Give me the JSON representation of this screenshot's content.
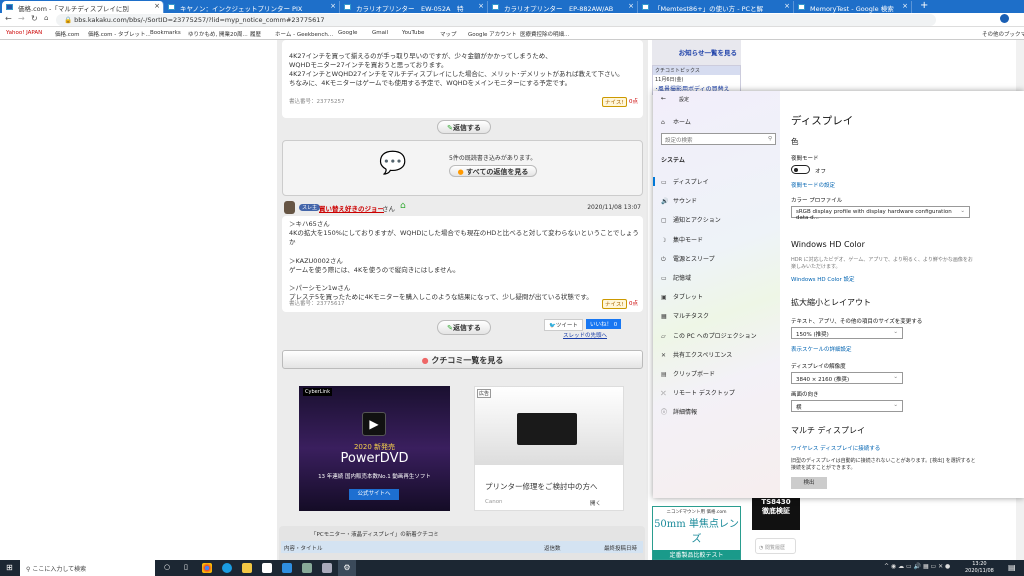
{
  "browser": {
    "tabs": [
      {
        "title": "価格.com -「マルチディスプレイに別",
        "active": true
      },
      {
        "title": "キヤノン：インクジェットプリンター PIX"
      },
      {
        "title": "カラリオプリンター　EW-052A　特"
      },
      {
        "title": "カラリオプリンター　EP-882AW/AB"
      },
      {
        "title": "「Memtest86+」の使い方 - PCと解"
      },
      {
        "title": "MemoryTest - Google 検索"
      }
    ],
    "url": "bbs.kakaku.com/bbs/-/SortID=23775257/?lid=myp_notice_comm#23775617",
    "bookmarks": [
      "Yahoo! JAPAN",
      "価格.com",
      "価格.com - タブレット...",
      "Bookmarks",
      "ゆりかもめ, 開業20周...",
      "履歴",
      "ホーム - Geekbench...",
      "Google",
      "Gmail",
      "YouTube",
      "マップ",
      "Google アカウント",
      "医療費控除の明細..."
    ],
    "other_bookmarks": "その他のブックマーク"
  },
  "forum": {
    "post1": {
      "lines": [
        "4K27インチを買って揃えるのが手っ取り早いのですが、少々金額がかかってしまうため、",
        "WQHDモニター27インチを買おうと思っております。",
        "4K27インチとWQHD27インチをマルチディスプレイにした場合に、メリット･デメリットがあれば教えて下さい。",
        "ちなみに、4Kモニターはゲームでも使用する予定で、WQHDをメインモニターにする予定です。"
      ],
      "number": "書込番号：23775257",
      "nice": "ナイス!",
      "points": "0点"
    },
    "reply_label": "返信する",
    "unread_text": "5件の既読書き込みがあります。",
    "all_replies": "すべての返信を見る",
    "post2": {
      "badge": "スレ主",
      "author": "買い替え好きのジョー",
      "suffix": "さん",
      "date": "2020/11/08 13:07",
      "lines": [
        "＞キハ65さん",
        "4Kの拡大を150%にしておりますが、WQHDにした場合でも現在のHDと比べると対して変わらないということでしょうか",
        "",
        "＞KAZU0002さん",
        "ゲームを使う際には、4Kを使うので縦向きにはしません。",
        "",
        "＞パーシモン1wさん",
        "プレステ5を買ったために4Kモニターを購入しこのような結果になって、少し疑問が出ている状態です。"
      ],
      "number": "書込番号：23775617",
      "nice": "ナイス!",
      "points": "0点"
    },
    "tweet": "ツイート",
    "like": "いいね！ 0",
    "thread_top": "スレッドの先頭へ",
    "kuchikomi_list": "クチコミ一覧を見る",
    "ad1": {
      "brand": "CyberLink",
      "headline": "2020 新発売",
      "product": "PowerDVD",
      "sub": "13 年連続 国内販売本数No.1 動画再生ソフト",
      "cta": "公式サイトへ"
    },
    "ad2": {
      "tag": "広告",
      "headline": "プリンター修理をご検討中の方へ",
      "advertiser": "Canon",
      "open": "開く"
    },
    "new_section": {
      "title": "「PCモニター・液晶ディスプレイ」の新着クチコミ",
      "col_title": "内容・タイトル",
      "col_replies": "返信数",
      "col_date": "最終投稿日時"
    }
  },
  "sidebar": {
    "notice_link": "お知らせ一覧を見る",
    "topics_title": "クチコミトピックス",
    "topics_date": "11月6日(金)",
    "topics_link": "･風景撮影用ボディの買替え",
    "ad_lens": {
      "top": "ニコンFマウント用 価格.com",
      "big": "50mm 単焦点レンズ",
      "bottom": "定番製品比較テスト"
    },
    "ad_ts": {
      "line1": "TS8430",
      "line2": "徹底検証"
    },
    "history": "閲覧履歴"
  },
  "settings": {
    "title": "設定",
    "home": "ホーム",
    "search_placeholder": "設定の検索",
    "section": "システム",
    "nav": [
      {
        "label": "ディスプレイ",
        "icon": "monitor-icon",
        "g": "▭",
        "active": true
      },
      {
        "label": "サウンド",
        "icon": "speaker-icon",
        "g": "🔊"
      },
      {
        "label": "通知とアクション",
        "icon": "notification-icon",
        "g": "▢"
      },
      {
        "label": "集中モード",
        "icon": "moon-icon",
        "g": "☽"
      },
      {
        "label": "電源とスリープ",
        "icon": "power-icon",
        "g": "⏻"
      },
      {
        "label": "記憶域",
        "icon": "storage-icon",
        "g": "▭"
      },
      {
        "label": "タブレット",
        "icon": "tablet-icon",
        "g": "▣"
      },
      {
        "label": "マルチタスク",
        "icon": "multitask-icon",
        "g": "▦"
      },
      {
        "label": "この PC へのプロジェクション",
        "icon": "projection-icon",
        "g": "▱"
      },
      {
        "label": "共有エクスペリエンス",
        "icon": "shared-icon",
        "g": "✕"
      },
      {
        "label": "クリップボード",
        "icon": "clipboard-icon",
        "g": "▤"
      },
      {
        "label": "リモート デスクトップ",
        "icon": "remote-icon",
        "g": "⤫"
      },
      {
        "label": "詳細情報",
        "icon": "info-icon",
        "g": "ⓘ"
      }
    ],
    "page_title": "ディスプレイ",
    "color_heading": "色",
    "night_mode": "夜間モード",
    "night_state": "オフ",
    "night_link": "夜間モードの設定",
    "profile_label": "カラー プロファイル",
    "profile_value": "sRGB display profile with display hardware configuration data d...",
    "hd_heading": "Windows HD Color",
    "hd_desc": "HDR に対応したビデオ、ゲーム、アプリで、より明るく、より鮮やかな画像をお楽しみいただけます。",
    "hd_link": "Windows HD Color 設定",
    "scale_heading": "拡大縮小とレイアウト",
    "scale_label": "テキスト、アプリ、その他の項目のサイズを変更する",
    "scale_value": "150% (推奨)",
    "scale_link": "表示スケールの詳細設定",
    "res_label": "ディスプレイの解像度",
    "res_value": "3840 × 2160 (推奨)",
    "orient_label": "画面の向き",
    "orient_value": "横",
    "multi_heading": "マルチ ディスプレイ",
    "wireless_link": "ワイヤレス ディスプレイに接続する",
    "multi_desc": "旧型のディスプレイは自動的に接続されないことがあります。[検出] を選択すると接続を試すことができます。",
    "detect": "検出"
  },
  "taskbar": {
    "search": "ここに入力して検索",
    "time": "13:20",
    "date": "2020/11/08"
  }
}
